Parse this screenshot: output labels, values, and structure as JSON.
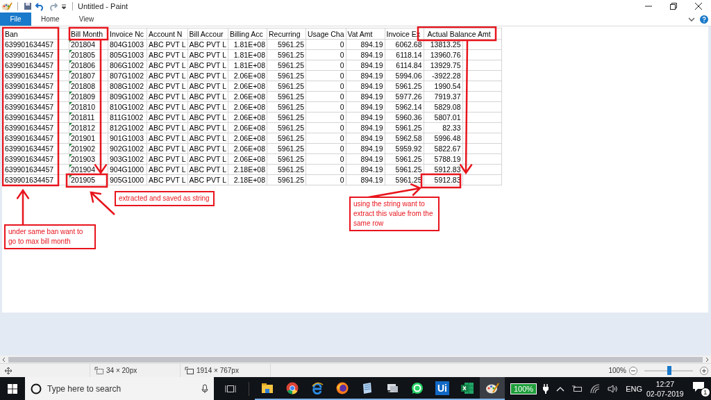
{
  "window": {
    "title": "Untitled - Paint"
  },
  "ribbon_tabs": [
    {
      "label": "File",
      "kind": "menu"
    },
    {
      "label": "Home",
      "kind": "tab"
    },
    {
      "label": "View",
      "kind": "tab"
    }
  ],
  "canvas": {
    "spreadsheet": {
      "columns": [
        {
          "label": "Ban",
          "kind": "text"
        },
        {
          "label": "Bill Month",
          "kind": "text",
          "flagged": true
        },
        {
          "label": "Invoice Nc",
          "kind": "text"
        },
        {
          "label": "Account N",
          "kind": "text"
        },
        {
          "label": "Bill Accour",
          "kind": "text"
        },
        {
          "label": "Billing Acc",
          "kind": "number"
        },
        {
          "label": "Recurring",
          "kind": "number"
        },
        {
          "label": "Usage Cha",
          "kind": "number"
        },
        {
          "label": "Vat Amt",
          "kind": "number"
        },
        {
          "label": "Invoice Ex",
          "kind": "number"
        },
        {
          "label": "Actual Balance Amt",
          "kind": "number"
        }
      ],
      "rows": [
        [
          "639901634457",
          "201804",
          "804G1003",
          "ABC PVT L",
          "ABC PVT L",
          "1.81E+08",
          "5961.25",
          "0",
          "894.19",
          "6062.68",
          "13813.25"
        ],
        [
          "639901634457",
          "201805",
          "805G1003",
          "ABC PVT L",
          "ABC PVT L",
          "1.81E+08",
          "5961.25",
          "0",
          "894.19",
          "6118.14",
          "13960.76"
        ],
        [
          "639901634457",
          "201806",
          "806G1002",
          "ABC PVT L",
          "ABC PVT L",
          "1.81E+08",
          "5961.25",
          "0",
          "894.19",
          "6114.84",
          "13929.75"
        ],
        [
          "639901634457",
          "201807",
          "807G1002",
          "ABC PVT L",
          "ABC PVT L",
          "2.06E+08",
          "5961.25",
          "0",
          "894.19",
          "5994.06",
          "-3922.28"
        ],
        [
          "639901634457",
          "201808",
          "808G1002",
          "ABC PVT L",
          "ABC PVT L",
          "2.06E+08",
          "5961.25",
          "0",
          "894.19",
          "5961.25",
          "1990.54"
        ],
        [
          "639901634457",
          "201809",
          "809G1002",
          "ABC PVT L",
          "ABC PVT L",
          "2.06E+08",
          "5961.25",
          "0",
          "894.19",
          "5977.26",
          "7919.37"
        ],
        [
          "639901634457",
          "201810",
          "810G1002",
          "ABC PVT L",
          "ABC PVT L",
          "2.06E+08",
          "5961.25",
          "0",
          "894.19",
          "5962.14",
          "5829.08"
        ],
        [
          "639901634457",
          "201811",
          "811G1002",
          "ABC PVT L",
          "ABC PVT L",
          "2.06E+08",
          "5961.25",
          "0",
          "894.19",
          "5960.36",
          "5807.01"
        ],
        [
          "639901634457",
          "201812",
          "812G1002",
          "ABC PVT L",
          "ABC PVT L",
          "2.06E+08",
          "5961.25",
          "0",
          "894.19",
          "5961.25",
          "82.33"
        ],
        [
          "639901634457",
          "201901",
          "901G1003",
          "ABC PVT L",
          "ABC PVT L",
          "2.06E+08",
          "5961.25",
          "0",
          "894.19",
          "5962.58",
          "5996.48"
        ],
        [
          "639901634457",
          "201902",
          "902G1002",
          "ABC PVT L",
          "ABC PVT L",
          "2.06E+08",
          "5961.25",
          "0",
          "894.19",
          "5959.92",
          "5822.67"
        ],
        [
          "639901634457",
          "201903",
          "903G1002",
          "ABC PVT L",
          "ABC PVT L",
          "2.06E+08",
          "5961.25",
          "0",
          "894.19",
          "5961.25",
          "5788.19"
        ],
        [
          "639901634457",
          "201904",
          "904G1000",
          "ABC PVT L",
          "ABC PVT L",
          "2.18E+08",
          "5961.25",
          "0",
          "894.19",
          "5961.25",
          "5912.83"
        ],
        [
          "639901634457",
          "201905",
          "905G1000",
          "ABC PVT L",
          "ABC PVT L",
          "2.18E+08",
          "5961.25",
          "0",
          "894.19",
          "5961.25",
          "5912.83"
        ]
      ]
    },
    "notes": [
      "under same ban want to go to max bill month",
      "extracted and saved as string",
      "using the string want to extract this value from the same row"
    ]
  },
  "status_bar": {
    "selection_size": "34 × 20px",
    "image_size": "1914 × 767px",
    "zoom": "100%",
    "zoom_slider": {
      "level": 0.52
    }
  },
  "taskbar": {
    "search_placeholder": "Type here to search",
    "app_label": "Ui",
    "battery": "100%",
    "language": "ENG",
    "time": "12:27",
    "date": "02-07-2019",
    "notification_count": "1"
  }
}
